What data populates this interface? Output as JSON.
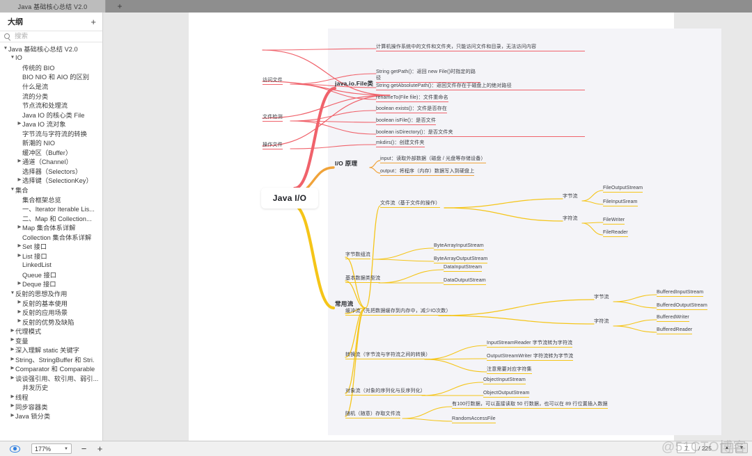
{
  "window": {
    "tab_title": "Java 基础核心总结 V2.0",
    "new_tab_label": "+"
  },
  "sidebar": {
    "title": "大纲",
    "add_label": "+",
    "search_placeholder": "搜索",
    "search_value": "",
    "items": [
      {
        "label": "Java 基础核心总结 V2.0",
        "indent": 0,
        "twisty": "down"
      },
      {
        "label": "IO",
        "indent": 1,
        "twisty": "down"
      },
      {
        "label": "传统的 BIO",
        "indent": 2,
        "twisty": "none"
      },
      {
        "label": "BIO NIO 和 AIO 的区别",
        "indent": 2,
        "twisty": "none"
      },
      {
        "label": "什么是流",
        "indent": 2,
        "twisty": "none"
      },
      {
        "label": "流的分类",
        "indent": 2,
        "twisty": "none"
      },
      {
        "label": "节点流和处理流",
        "indent": 2,
        "twisty": "none"
      },
      {
        "label": "Java IO 的核心类 File",
        "indent": 2,
        "twisty": "none"
      },
      {
        "label": "Java IO 流对象",
        "indent": 2,
        "twisty": "right"
      },
      {
        "label": "字节流与字符流的转换",
        "indent": 2,
        "twisty": "none"
      },
      {
        "label": "新潮的 NIO",
        "indent": 2,
        "twisty": "none"
      },
      {
        "label": "缓冲区（Buffer）",
        "indent": 2,
        "twisty": "none"
      },
      {
        "label": "通道（Channel）",
        "indent": 2,
        "twisty": "right"
      },
      {
        "label": "选择器（Selectors）",
        "indent": 2,
        "twisty": "none"
      },
      {
        "label": "选择键（SelectionKey）",
        "indent": 2,
        "twisty": "right"
      },
      {
        "label": "集合",
        "indent": 1,
        "twisty": "down"
      },
      {
        "label": "集合框架总览",
        "indent": 2,
        "twisty": "none"
      },
      {
        "label": "一、Iterator  Iterable Lis...",
        "indent": 2,
        "twisty": "none"
      },
      {
        "label": "二、Map 和 Collection...",
        "indent": 2,
        "twisty": "none"
      },
      {
        "label": "Map 集合体系详解",
        "indent": 2,
        "twisty": "right"
      },
      {
        "label": "Collection 集合体系详解",
        "indent": 2,
        "twisty": "none"
      },
      {
        "label": "Set 接口",
        "indent": 2,
        "twisty": "right"
      },
      {
        "label": "List 接口",
        "indent": 2,
        "twisty": "right"
      },
      {
        "label": "LinkedList",
        "indent": 2,
        "twisty": "none"
      },
      {
        "label": "Queue 接口",
        "indent": 2,
        "twisty": "none"
      },
      {
        "label": "Deque 接口",
        "indent": 2,
        "twisty": "right"
      },
      {
        "label": "反射的思想及作用",
        "indent": 1,
        "twisty": "down"
      },
      {
        "label": "反射的基本使用",
        "indent": 2,
        "twisty": "right"
      },
      {
        "label": "反射的应用场景",
        "indent": 2,
        "twisty": "right"
      },
      {
        "label": "反射的优势及缺陷",
        "indent": 2,
        "twisty": "right"
      },
      {
        "label": "代理模式",
        "indent": 1,
        "twisty": "right"
      },
      {
        "label": "变量",
        "indent": 1,
        "twisty": "right"
      },
      {
        "label": "深入理解 static 关键字",
        "indent": 1,
        "twisty": "right"
      },
      {
        "label": "String、StringBuffer 和 Stri.",
        "indent": 1,
        "twisty": "right"
      },
      {
        "label": "Comparator 和 Comparable",
        "indent": 1,
        "twisty": "right"
      },
      {
        "label": "谈谈强引用、软引用、弱引...",
        "indent": 1,
        "twisty": "right"
      },
      {
        "label": "并发历史",
        "indent": 2,
        "twisty": "none"
      },
      {
        "label": "线程",
        "indent": 1,
        "twisty": "right"
      },
      {
        "label": "同步容器类",
        "indent": 1,
        "twisty": "right"
      },
      {
        "label": "Java 锁分类",
        "indent": 1,
        "twisty": "right"
      }
    ]
  },
  "mindmap": {
    "root": "Java I/O",
    "colors": {
      "red": "#f0626b",
      "orange": "#f0a33a",
      "yellow": "#f5c518"
    },
    "branches": [
      {
        "name": "java.io.File类",
        "color": "red",
        "children": [
          {
            "name": "",
            "leaves": [
              "计算机操作系统中的文件和文件夹，只能访问文件和目录，无法访问内容"
            ]
          },
          {
            "name": "访问文件",
            "leaves": [
              "String getPath()：返回 new File()时指定的路径",
              "String getAbsolutePath()：返回文件存在于磁盘上的绝对路径",
              "renameTo(File file)：文件重命名"
            ]
          },
          {
            "name": "文件检测",
            "leaves": [
              "boolean exists()：文件是否存在",
              "boolean isFile()：是否文件",
              "boolean isDirectory()：是否文件夹"
            ]
          },
          {
            "name": "操作文件",
            "leaves": [
              "mkdirs()：创建文件夹"
            ]
          }
        ]
      },
      {
        "name": "I/O 原理",
        "color": "orange",
        "children": [
          {
            "name": "",
            "leaves": [
              "input：读取外部数据（磁盘 / 光盘等存储设备）",
              "output：将程序（内存）数据写入到硬盘上"
            ]
          }
        ]
      },
      {
        "name": "常用流",
        "color": "yellow",
        "children": [
          {
            "name": "文件流（基于文件的操作）",
            "groups": [
              {
                "name": "字节流",
                "leaves": [
                  "FileOutputStream",
                  "FileInputSream"
                ]
              },
              {
                "name": "字符流",
                "leaves": [
                  "FileWriter",
                  "FileReader"
                ]
              }
            ]
          },
          {
            "name": "字节数组流",
            "leaves": [
              "ByteArrayInputStream",
              "ByteArrayOutputStream"
            ]
          },
          {
            "name": "基本数据类型流",
            "leaves": [
              "DataInputStream",
              "DataOutputStream"
            ]
          },
          {
            "name": "缓冲流（先把数据缓存到内存中，减少IO次数）",
            "groups": [
              {
                "name": "字节流",
                "leaves": [
                  "BufferedInputStream",
                  "BufferedOutputStream"
                ]
              },
              {
                "name": "字符流",
                "leaves": [
                  "BufferedWriter",
                  "BufferedReader"
                ]
              }
            ]
          },
          {
            "name": "转换流（字节流与字符流之间的转换）",
            "leaves": [
              "InputStreamReader 字节流转为字符流",
              "OutputStreamWriter 字符流转为字节流",
              "注意需要对应字符集"
            ]
          },
          {
            "name": "对象流（对象的序列化与反序列化）",
            "leaves": [
              "ObjectInputStream",
              "ObjectOutputStream"
            ]
          },
          {
            "name": "随机（随意）存取文件流",
            "leaves": [
              "有100行数据，可以直接读取 50 行数据，也可以在 89 行位置插入数据",
              "RandomAccessFile"
            ]
          }
        ]
      }
    ]
  },
  "statusbar": {
    "zoom": "177%",
    "zoom_out_label": "−",
    "zoom_in_label": "+",
    "page_current": "7",
    "page_total": "/ 225",
    "prev_label": "▲",
    "next_label": "▼"
  },
  "watermark": "@51CTO博客"
}
